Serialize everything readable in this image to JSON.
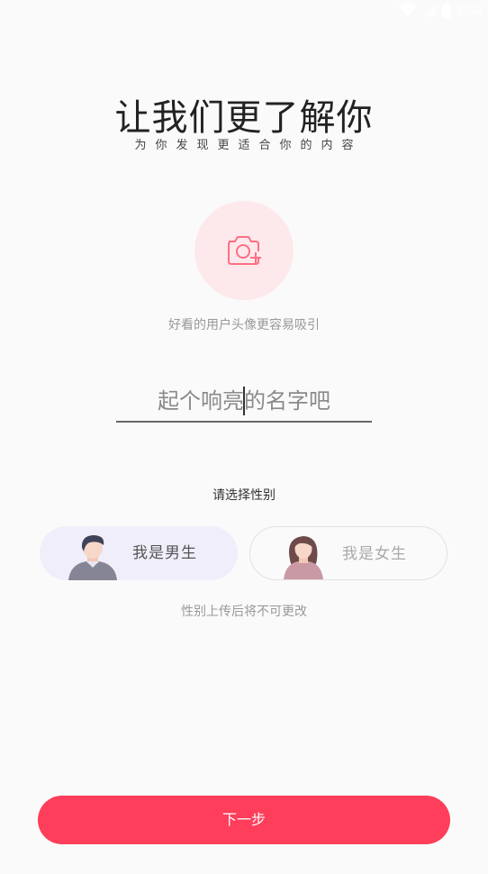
{
  "status_bar": {
    "time": "3:02",
    "icons": [
      "wifi-icon",
      "signal-icon",
      "battery-icon"
    ]
  },
  "header": {
    "title": "让我们更了解你",
    "subtitle": "为你发现更适合你的内容"
  },
  "avatar": {
    "icon": "camera-add-icon",
    "hint": "好看的用户头像更容易吸引"
  },
  "name_field": {
    "placeholder": "起个响亮的名字吧",
    "value": ""
  },
  "gender": {
    "label": "请选择性别",
    "male_label": "我是男生",
    "female_label": "我是女生",
    "selected": "male",
    "note": "性别上传后将不可更改"
  },
  "footer": {
    "next_label": "下一步"
  },
  "colors": {
    "accent": "#fe3e5a",
    "avatar_bg": "#fde9ec",
    "male_selected_bg": "#f1eefc",
    "background": "#fafafa"
  }
}
